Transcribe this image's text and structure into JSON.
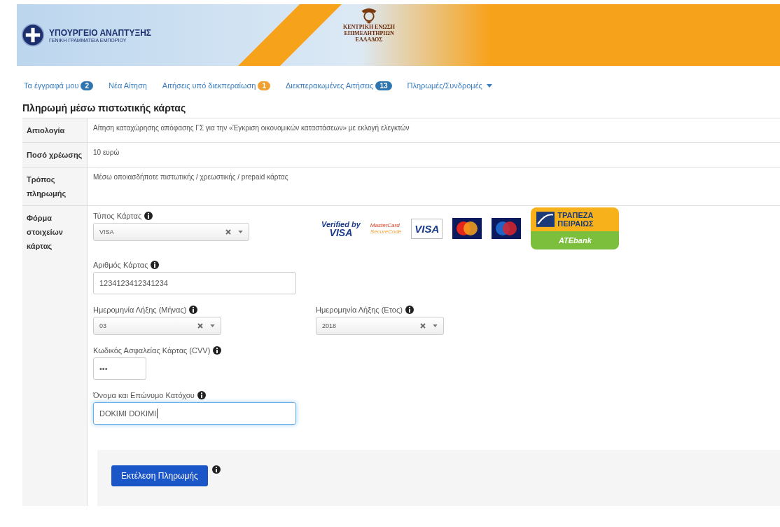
{
  "header": {
    "ministry_title": "ΥΠΟΥΡΓΕΙΟ ΑΝΑΠΤΥΞΗΣ",
    "ministry_subtitle": "ΓΕΝΙΚΗ ΓΡΑΜΜΑΤΕΙΑ ΕΜΠΟΡΙΟΥ",
    "emblem_caption": [
      "ΚΕΝΤΡΙΚΗ ΕΝΩΣΗ",
      "ΕΠΙΜΕΛΗΤΗΡΙΩΝ",
      "ΕΛΛΑΔΟΣ"
    ]
  },
  "nav": [
    {
      "kind": "link",
      "label": "Τα έγγραφά μου",
      "badge": "2",
      "color": "#2f76b1"
    },
    {
      "kind": "link",
      "label": "Νέα Αίτηση"
    },
    {
      "kind": "link",
      "label": "Αιτήσεις υπό διεκπεραίωση",
      "badge": "1",
      "color": "#f0a030"
    },
    {
      "kind": "link",
      "label": "Διεκπεραιωμένες Αιτήσεις",
      "badge": "13",
      "color": "#2f76b1"
    },
    {
      "kind": "dropdown",
      "label": "Πληρωμές/Συνδρομές"
    }
  ],
  "page_title": "Πληρωμή μέσω πιστωτικής κάρτας",
  "details": [
    {
      "label": "Αιτιολογία",
      "value": "Αίτηση καταχώρησης απόφασης ΓΣ για την «Έγκριση οικονομικών καταστάσεων» με εκλογή ελεγκτών"
    },
    {
      "label": "Ποσό χρέωσης",
      "value": "10 ευρώ"
    },
    {
      "label": "Τρόπος πληρωμής",
      "value": "Μέσω οποιασδήποτε πιστωτικής / χρεωστικής / prepaid κάρτας"
    }
  ],
  "form": {
    "label": "Φόρμα στοιχείων κάρτας",
    "card_logos": [
      {
        "kind": "verified",
        "lines": [
          "Verified by",
          "VISA"
        ]
      },
      {
        "kind": "securecode",
        "lines": [
          "MasterCard",
          "SecureCode"
        ]
      },
      {
        "kind": "visa",
        "lines": [
          "VISA"
        ]
      },
      {
        "kind": "mastercard"
      },
      {
        "kind": "maestro"
      },
      {
        "kind": "bank",
        "lines": [
          "ΤΡΑΠΕΖΑ",
          "ΠΕΙΡΑΙΩΣ",
          "ATEbank"
        ]
      }
    ],
    "rows": [
      {
        "fields": [
          {
            "kind": "select",
            "label": "Τύπος Κάρτας",
            "value": "VISA"
          }
        ]
      },
      {
        "fields": [
          {
            "kind": "text",
            "label": "Αριθμός Κάρτας",
            "value": "1234123412341234"
          }
        ]
      },
      {
        "fields": [
          {
            "kind": "select",
            "label": "Ημερομηνία Λήξης (Μήνας)",
            "value": "03"
          },
          {
            "kind": "select",
            "label": "Ημερομηνία Λήξης (Ετος)",
            "value": "2018"
          }
        ]
      },
      {
        "fields": [
          {
            "kind": "password",
            "label": "Κωδικός Ασφαλείας Κάρτας (CVV)",
            "value": "•••"
          }
        ]
      },
      {
        "fields": [
          {
            "kind": "text",
            "label": "Όνομα και Επώνυμο Κατόχου",
            "value": "DOKIMI DOKIMI",
            "focused": true
          }
        ]
      }
    ]
  },
  "submit": {
    "label": "Εκτέλεση Πληρωμής"
  }
}
